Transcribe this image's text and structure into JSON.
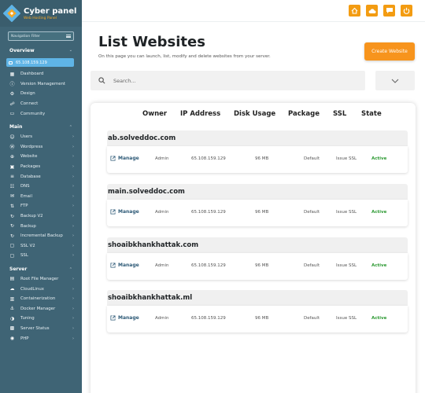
{
  "brand": {
    "name": "Cyber panel",
    "tagline": "Web Hosting Panel"
  },
  "nav_filter": {
    "label": "Navigation Filter"
  },
  "overview": {
    "heading": "Overview",
    "ip": "65.108.159.129",
    "items": [
      {
        "label": "Dashboard",
        "icon": "dashboard-icon"
      },
      {
        "label": "Version Management",
        "icon": "info-icon"
      },
      {
        "label": "Design",
        "icon": "gear-icon"
      },
      {
        "label": "Connect",
        "icon": "link-icon"
      },
      {
        "label": "Community",
        "icon": "chat-icon"
      }
    ]
  },
  "main_section": {
    "heading": "Main",
    "items": [
      {
        "label": "Users",
        "icon": "users-icon"
      },
      {
        "label": "Wordpress",
        "icon": "wordpress-icon"
      },
      {
        "label": "Website",
        "icon": "globe-icon"
      },
      {
        "label": "Packages",
        "icon": "package-icon"
      },
      {
        "label": "Database",
        "icon": "database-icon"
      },
      {
        "label": "DNS",
        "icon": "dns-icon"
      },
      {
        "label": "Email",
        "icon": "mail-icon"
      },
      {
        "label": "FTP",
        "icon": "ftp-icon"
      },
      {
        "label": "Backup V2",
        "icon": "backup-icon"
      },
      {
        "label": "Backup",
        "icon": "backup-icon"
      },
      {
        "label": "Incremental Backup",
        "icon": "backup-icon"
      },
      {
        "label": "SSL V2",
        "icon": "lock-icon"
      },
      {
        "label": "SSL",
        "icon": "lock-icon"
      }
    ]
  },
  "server_section": {
    "heading": "Server",
    "items": [
      {
        "label": "Root File Manager",
        "icon": "folder-icon"
      },
      {
        "label": "CloudLinux",
        "icon": "cloud-icon"
      },
      {
        "label": "Containerization",
        "icon": "container-icon"
      },
      {
        "label": "Docker Manager",
        "icon": "docker-icon"
      },
      {
        "label": "Tuning",
        "icon": "tuning-icon"
      },
      {
        "label": "Server Status",
        "icon": "status-icon"
      },
      {
        "label": "PHP",
        "icon": "php-icon"
      }
    ]
  },
  "page": {
    "title": "List Websites",
    "subtitle": "On this page you can launch, list, modify and delete websites from your server.",
    "create_label": "Create Website",
    "search_placeholder": "Search..."
  },
  "table": {
    "columns": [
      "Owner",
      "IP Address",
      "Disk Usage",
      "Package",
      "SSL",
      "State"
    ],
    "manage_label": "Manage",
    "rows": [
      {
        "domain": "ab.solveddoc.com",
        "owner": "Admin",
        "ip": "65.108.159.129",
        "disk": "96 MB",
        "package": "Default",
        "ssl": "Issue SSL",
        "state": "Active"
      },
      {
        "domain": "main.solveddoc.com",
        "owner": "Admin",
        "ip": "65.108.159.129",
        "disk": "96 MB",
        "package": "Default",
        "ssl": "Issue SSL",
        "state": "Active"
      },
      {
        "domain": "shoaibkhankhattak.com",
        "owner": "Admin",
        "ip": "65.108.159.129",
        "disk": "96 MB",
        "package": "Default",
        "ssl": "Issue SSL",
        "state": "Active"
      },
      {
        "domain": "shoaibkhankhattak.ml",
        "owner": "Admin",
        "ip": "65.108.159.129",
        "disk": "96 MB",
        "package": "Default",
        "ssl": "Issue SSL",
        "state": "Active"
      }
    ]
  },
  "colors": {
    "sidebar": "#3f6475",
    "accent": "#f7941d",
    "active": "#2e9a34",
    "link": "#2e5a77"
  }
}
